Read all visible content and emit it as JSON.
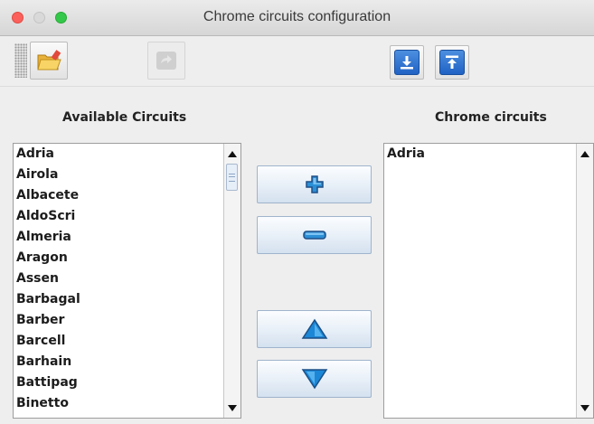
{
  "window": {
    "title": "Chrome circuits configuration"
  },
  "toolbar": {
    "icons": [
      "open-folder-icon",
      "redo-icon",
      "import-download-icon",
      "export-upload-icon"
    ]
  },
  "available": {
    "heading": "Available Circuits",
    "items": [
      "Adria",
      "Airola",
      "Albacete",
      "AldoScri",
      "Almeria",
      "Aragon",
      "Assen",
      "Barbagal",
      "Barber",
      "Barcell",
      "Barhain",
      "Battipag",
      "Binetto"
    ]
  },
  "chrome": {
    "heading": "Chrome circuits",
    "items": [
      "Adria"
    ]
  },
  "actions": {
    "icons": [
      "plus-icon",
      "minus-icon",
      "move-up-icon",
      "move-down-icon"
    ]
  },
  "colors": {
    "accent_blue": "#2b8fd6"
  }
}
